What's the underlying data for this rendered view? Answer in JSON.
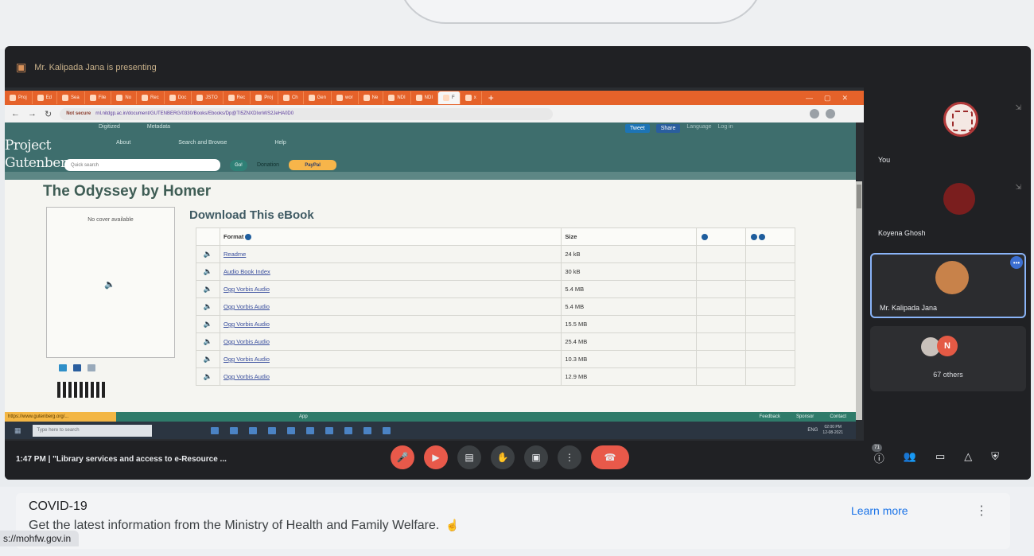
{
  "meet": {
    "presenting_text": "Mr. Kalipada Jana is presenting",
    "meeting_time": "1:47 PM",
    "meeting_title": "\"Library services and access to e-Resource ...",
    "participants_badge": "71",
    "participants": [
      {
        "name": "You"
      },
      {
        "name": "Koyena Ghosh"
      },
      {
        "name": "Mr. Kalipada Jana"
      },
      {
        "name": "67 others",
        "initial": "N"
      }
    ]
  },
  "browser": {
    "url_warning": "Not secure",
    "url": "rnl.nitdgp.ac.in/document/GUTENBERG/0330/Books/Ebooks/Dp@TI5ZNXDIxnWS2JeHA0D0",
    "tabs": [
      "Proj",
      "Ed",
      "Sea",
      "File",
      "No",
      "Rec",
      "Doc",
      "JSTO",
      "Rec",
      "Proj",
      "Ch",
      "Gen",
      "wor",
      "Ne",
      "NDI",
      "NDI",
      "F",
      "x"
    ]
  },
  "gutenberg": {
    "menu_top": [
      "Digitized",
      "Metadata"
    ],
    "menu": [
      "About",
      "Search and Browse",
      "Help"
    ],
    "logo_line1": "Project",
    "logo_line2": "Gutenberg",
    "social_tweet": "Tweet",
    "social_share": "Share",
    "language": "Language",
    "login": "Log in",
    "search_placeholder": "Quick search",
    "go_label": "Go!",
    "donation_label": "Donation",
    "paypal_label": "PayPal",
    "book_title": "The Odyssey by Homer",
    "no_cover": "No cover available",
    "download_title": "Download This eBook",
    "table_header": {
      "format": "Format",
      "size": "Size"
    },
    "files": [
      {
        "format": "Readme",
        "size": "24 kB"
      },
      {
        "format": "Audio Book Index",
        "size": "30 kB"
      },
      {
        "format": "Ogg Vorbis Audio",
        "size": "5.4 MB"
      },
      {
        "format": "Ogg Vorbis Audio",
        "size": "5.4 MB"
      },
      {
        "format": "Ogg Vorbis Audio",
        "size": "15.5 MB"
      },
      {
        "format": "Ogg Vorbis Audio",
        "size": "25.4 MB"
      },
      {
        "format": "Ogg Vorbis Audio",
        "size": "10.3 MB"
      },
      {
        "format": "Ogg Vorbis Audio",
        "size": "12.9 MB"
      }
    ],
    "footer_app": "App",
    "footer_links": [
      "Feedback",
      "Sponsor",
      "Contact"
    ],
    "status_tip": "https://www.gutenberg.org/..."
  },
  "taskbar": {
    "search_placeholder": "Type here to search",
    "lang": "ENG",
    "time": "02:00 PM",
    "date": "12-08-2021"
  },
  "banner": {
    "title": "COVID-19",
    "text": "Get the latest information from the Ministry of Health and Family Welfare.",
    "learn_more": "Learn more",
    "status_url": "s://mohfw.gov.in"
  }
}
